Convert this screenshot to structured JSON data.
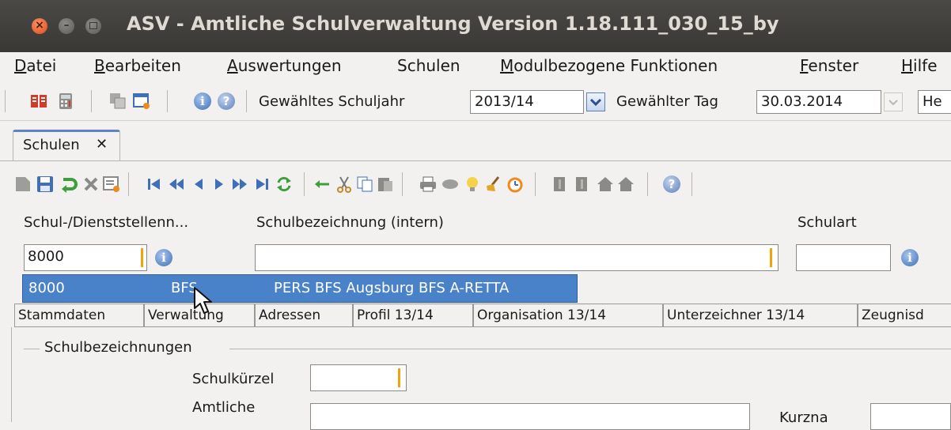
{
  "window": {
    "title": "ASV - Amtliche Schulverwaltung Version 1.18.111_030_15_by",
    "close_glyph": "×",
    "minimize_glyph": "–"
  },
  "menu": [
    {
      "label": "Datei",
      "mnemonic": "D",
      "rest": "atei"
    },
    {
      "label": "Bearbeiten",
      "mnemonic": "B",
      "rest": "earbeiten"
    },
    {
      "label": "Auswertungen",
      "mnemonic": "A",
      "rest": "uswertungen"
    },
    {
      "label": "Schulen",
      "mnemonic": "",
      "rest": "Schulen"
    },
    {
      "label": "Modulbezogene Funktionen",
      "mnemonic": "M",
      "rest": "odulbezogene Funktionen"
    },
    {
      "label": "Fenster",
      "mnemonic": "F",
      "rest": "enster"
    },
    {
      "label": "Hilfe",
      "mnemonic": "H",
      "rest": "ilfe"
    }
  ],
  "toolbar": {
    "schuljahr_label": "Gewähltes Schuljahr",
    "schuljahr_value": "2013/14",
    "tag_label": "Gewählter Tag",
    "tag_value": "30.03.2014",
    "extra_value": "He"
  },
  "tabs": [
    {
      "label": "Schulen",
      "close": "✕"
    }
  ],
  "form": {
    "schulnr_label": "Schul-/Dienststellenn...",
    "schulnr_value": "8000",
    "bezeichnung_label": "Schulbezeichnung (intern)",
    "bezeichnung_value": "",
    "schulart_label": "Schulart",
    "schulart_value": "",
    "info_glyph": "i"
  },
  "dropdown": {
    "number": "8000",
    "code": "BFS",
    "name": "PERS BFS Augsburg BFS A-RETTA"
  },
  "subtabs": [
    "Stammdaten",
    "Verwaltung",
    "Adressen",
    "Profil 13/14",
    "Organisation 13/14",
    "Unterzeichner 13/14",
    "Zeugnisd"
  ],
  "section": {
    "title": "Schulbezeichnungen",
    "schulkuerzel_label": "Schulkürzel",
    "amtliche_label": "Amtliche",
    "kurzname_label": "Kurzna"
  },
  "colors": {
    "titlebar": "#3c3b37",
    "selection": "#4a82c9",
    "caret": "#f0a30a"
  }
}
